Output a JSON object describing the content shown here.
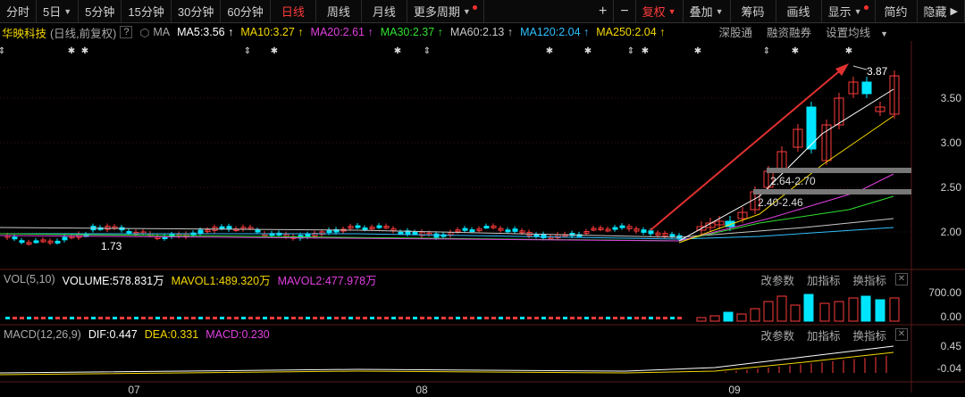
{
  "toolbar": {
    "periods": [
      "分时",
      "5日",
      "5分钟",
      "15分钟",
      "30分钟",
      "60分钟",
      "日线",
      "周线",
      "月线",
      "更多周期"
    ],
    "active": "日线",
    "right": [
      "复权",
      "叠加",
      "筹码",
      "画线",
      "显示",
      "简约",
      "隐藏"
    ]
  },
  "stock": {
    "name": "华映科技",
    "mode": "(日线,前复权)",
    "ma_label": "MA",
    "ma": [
      {
        "label": "MA5:3.56",
        "color": "#ffffff"
      },
      {
        "label": "MA10:3.27",
        "color": "#f5d800"
      },
      {
        "label": "MA20:2.61",
        "color": "#e040e0"
      },
      {
        "label": "MA30:2.37",
        "color": "#30e030"
      },
      {
        "label": "MA60:2.13",
        "color": "#c8c8c8"
      },
      {
        "label": "MA120:2.04",
        "color": "#30c0ff"
      },
      {
        "label": "MA250:2.04",
        "color": "#f5d800"
      }
    ],
    "links": [
      "深股通",
      "融资融券",
      "设置均线"
    ]
  },
  "price_axis": [
    "3.50",
    "3.00",
    "2.50",
    "2.00"
  ],
  "annotations": {
    "high": "3.87",
    "low": "1.73",
    "zone_upper": "2.64-2.70",
    "zone_lower": "2.40-2.46"
  },
  "volume": {
    "title": "VOL(5,10)",
    "volume": "VOLUME:578.831万",
    "mavol1": "MAVOL1:489.320万",
    "mavol2": "MAVOL2:477.978万",
    "axis": [
      "700.00",
      "0.00"
    ],
    "controls": [
      "改参数",
      "加指标",
      "换指标"
    ]
  },
  "macd": {
    "title": "MACD(12,26,9)",
    "dif": "DIF:0.447",
    "dea": "DEA:0.331",
    "macd": "MACD:0.230",
    "axis": [
      "0.45",
      "-0.04"
    ],
    "controls": [
      "改参数",
      "加指标",
      "换指标"
    ]
  },
  "months": [
    "07",
    "08",
    "09"
  ],
  "colors": {
    "up": "#ff3b3b",
    "down": "#00e5ff",
    "bg": "#000000"
  }
}
